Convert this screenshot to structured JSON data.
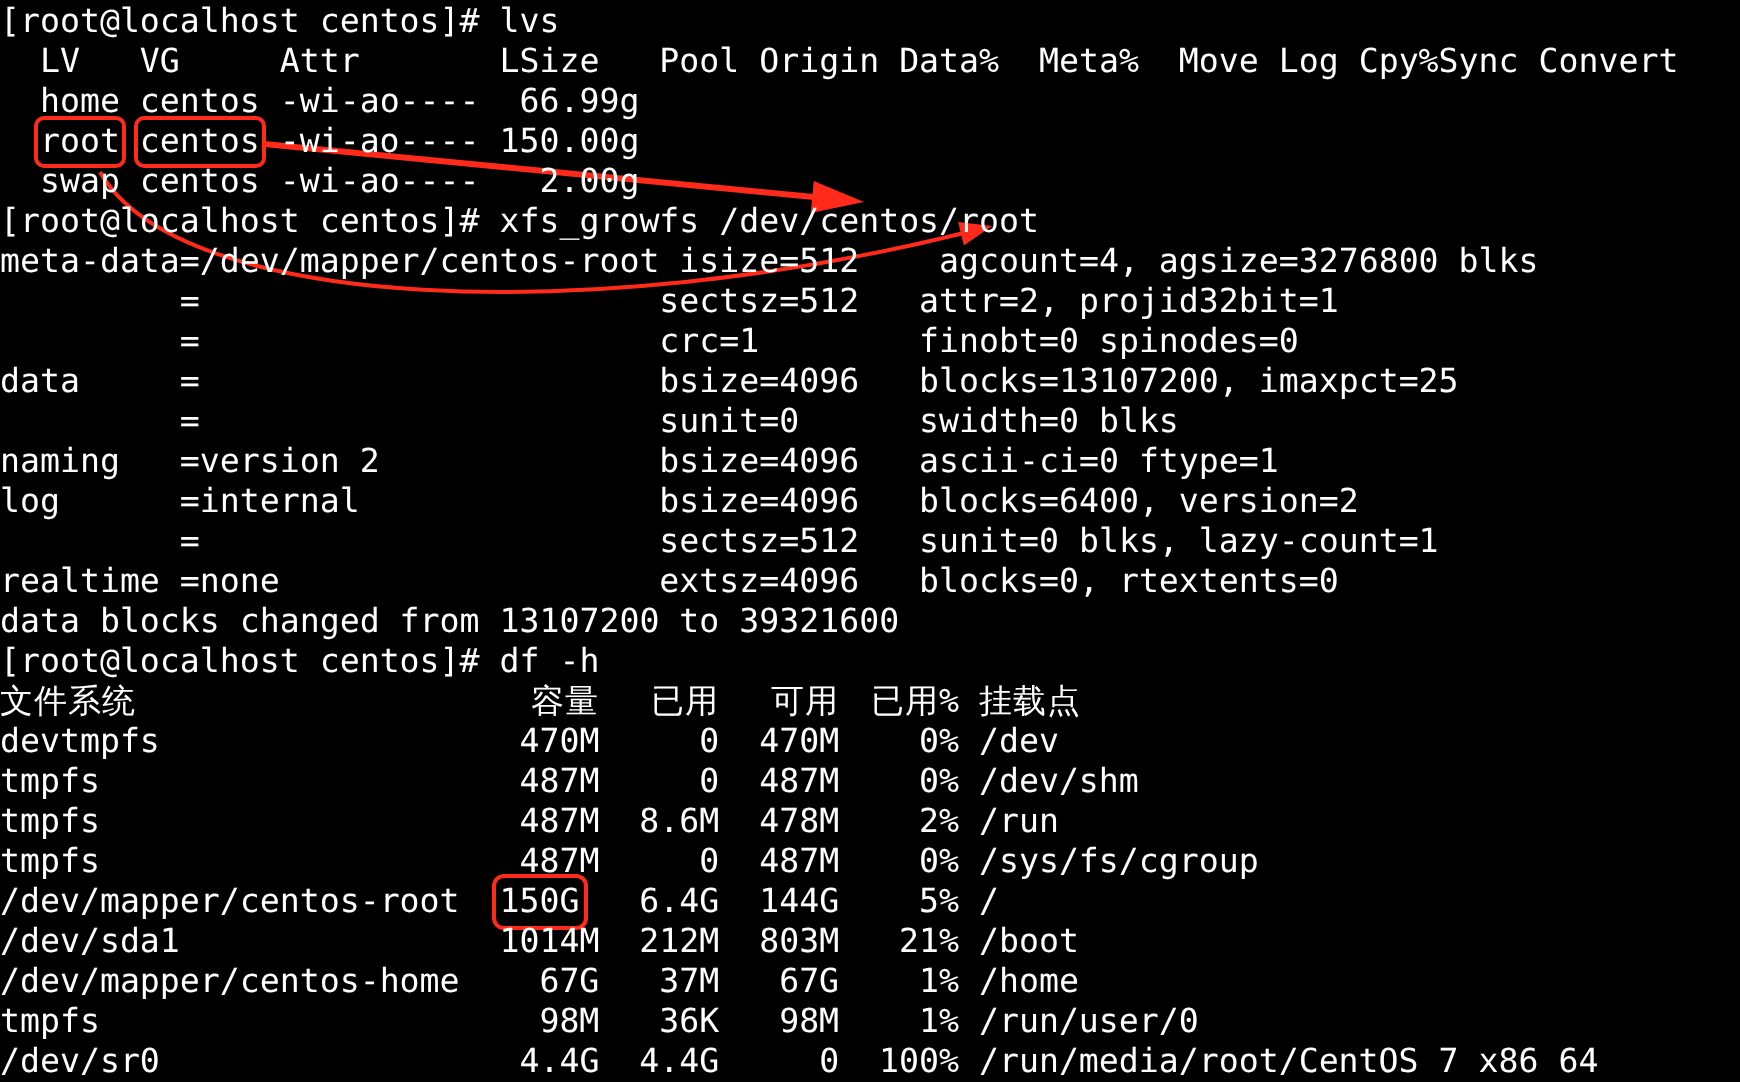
{
  "terminal": {
    "lines": [
      {
        "text": "[root@localhost centos]# lvs"
      },
      {
        "text": "  LV   VG     Attr       LSize   Pool Origin Data%  Meta%  Move Log Cpy%Sync Convert"
      },
      {
        "text": "  home centos -wi-ao----  66.99g"
      },
      {
        "segments": [
          {
            "text": "root",
            "boxed": true
          },
          {
            "text": "centos",
            "boxed": true
          },
          {
            "text": "-wi-ao---- 150.00g",
            "boxed": false
          }
        ]
      },
      {
        "text": "  swap centos -wi-ao----   2.00g"
      },
      {
        "text": "[root@localhost centos]# xfs_growfs /dev/centos/root"
      },
      {
        "text": "meta-data=/dev/mapper/centos-root isize=512    agcount=4, agsize=3276800 blks"
      },
      {
        "text": "         =                       sectsz=512   attr=2, projid32bit=1"
      },
      {
        "text": "         =                       crc=1        finobt=0 spinodes=0"
      },
      {
        "text": "data     =                       bsize=4096   blocks=13107200, imaxpct=25"
      },
      {
        "text": "         =                       sunit=0      swidth=0 blks"
      },
      {
        "text": "naming   =version 2              bsize=4096   ascii-ci=0 ftype=1"
      },
      {
        "text": "log      =internal               bsize=4096   blocks=6400, version=2"
      },
      {
        "text": "         =                       sectsz=512   sunit=0 blks, lazy-count=1"
      },
      {
        "text": "realtime =none                   extsz=4096   blocks=0, rtextents=0"
      },
      {
        "text": "data blocks changed from 13107200 to 39321600"
      },
      {
        "text": "[root@localhost centos]# df -h"
      }
    ],
    "df_table": {
      "columns": [
        "文件系统",
        "容量",
        "已用",
        "可用",
        "已用%",
        "挂载点"
      ],
      "rows": [
        [
          {
            "text": "devtmpfs"
          },
          {
            "text": "470M"
          },
          {
            "text": "0"
          },
          {
            "text": "470M"
          },
          {
            "text": "0%"
          },
          {
            "text": "/dev"
          }
        ],
        [
          {
            "text": "tmpfs"
          },
          {
            "text": "487M"
          },
          {
            "text": "0"
          },
          {
            "text": "487M"
          },
          {
            "text": "0%"
          },
          {
            "text": "/dev/shm"
          }
        ],
        [
          {
            "text": "tmpfs"
          },
          {
            "text": "487M"
          },
          {
            "text": "8.6M"
          },
          {
            "text": "478M"
          },
          {
            "text": "2%"
          },
          {
            "text": "/run"
          }
        ],
        [
          {
            "text": "tmpfs"
          },
          {
            "text": "487M"
          },
          {
            "text": "0"
          },
          {
            "text": "487M"
          },
          {
            "text": "0%"
          },
          {
            "text": "/sys/fs/cgroup"
          }
        ],
        [
          {
            "text": "/dev/mapper/centos-root"
          },
          {
            "text": "150G",
            "boxed": true
          },
          {
            "text": "6.4G"
          },
          {
            "text": "144G"
          },
          {
            "text": "5%"
          },
          {
            "text": "/"
          }
        ],
        [
          {
            "text": "/dev/sda1"
          },
          {
            "text": "1014M"
          },
          {
            "text": "212M"
          },
          {
            "text": "803M"
          },
          {
            "text": "21%"
          },
          {
            "text": "/boot"
          }
        ],
        [
          {
            "text": "/dev/mapper/centos-home"
          },
          {
            "text": "67G"
          },
          {
            "text": "37M"
          },
          {
            "text": "67G"
          },
          {
            "text": "1%"
          },
          {
            "text": "/home"
          }
        ],
        [
          {
            "text": "tmpfs"
          },
          {
            "text": "98M"
          },
          {
            "text": "36K"
          },
          {
            "text": "98M"
          },
          {
            "text": "1%"
          },
          {
            "text": "/run/user/0"
          }
        ],
        [
          {
            "text": "/dev/sr0"
          },
          {
            "text": "4.4G"
          },
          {
            "text": "4.4G"
          },
          {
            "text": "0"
          },
          {
            "text": "100%"
          },
          {
            "text": "/run/media/root/CentOS 7 x86 64"
          }
        ]
      ]
    },
    "annotations": [
      {
        "kind": "straight-arrow"
      },
      {
        "kind": "curved-arrow"
      }
    ]
  }
}
